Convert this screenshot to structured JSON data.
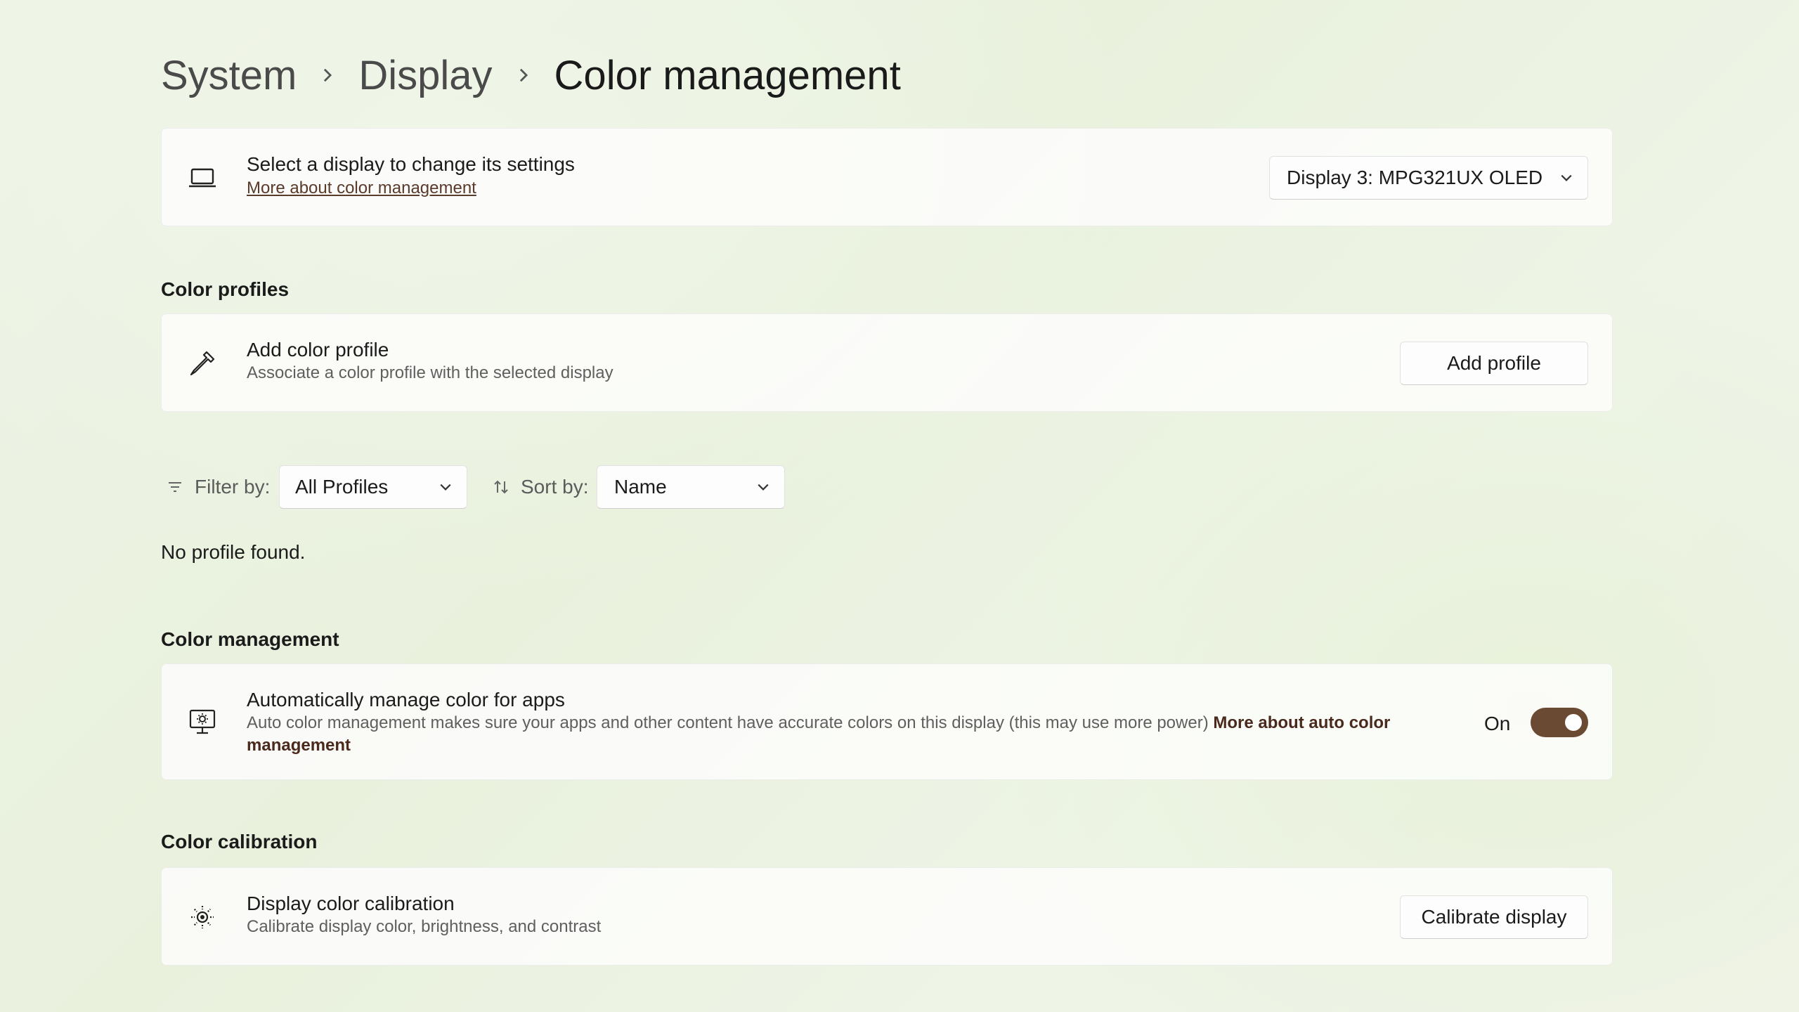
{
  "breadcrumb": {
    "items": [
      "System",
      "Display",
      "Color management"
    ]
  },
  "display_select": {
    "title": "Select a display to change its settings",
    "link": "More about color management",
    "dropdown_value": "Display 3: MPG321UX OLED"
  },
  "color_profiles": {
    "heading": "Color profiles",
    "add": {
      "title": "Add color profile",
      "subtitle": "Associate a color profile with the selected display",
      "button": "Add profile"
    },
    "filter_label": "Filter by:",
    "filter_value": "All Profiles",
    "sort_label": "Sort by:",
    "sort_value": "Name",
    "empty_text": "No profile found."
  },
  "color_management": {
    "heading": "Color management",
    "auto": {
      "title": "Automatically manage color for apps",
      "description": "Auto color management makes sure your apps and other content have accurate colors on this display (this may use more power)",
      "link": "More about auto color management",
      "toggle_state": "On"
    }
  },
  "color_calibration": {
    "heading": "Color calibration",
    "calibrate": {
      "title": "Display color calibration",
      "subtitle": "Calibrate display color, brightness, and contrast",
      "button": "Calibrate display"
    }
  },
  "colors": {
    "accent": "#6b4a34",
    "link": "#5a3a2a"
  }
}
